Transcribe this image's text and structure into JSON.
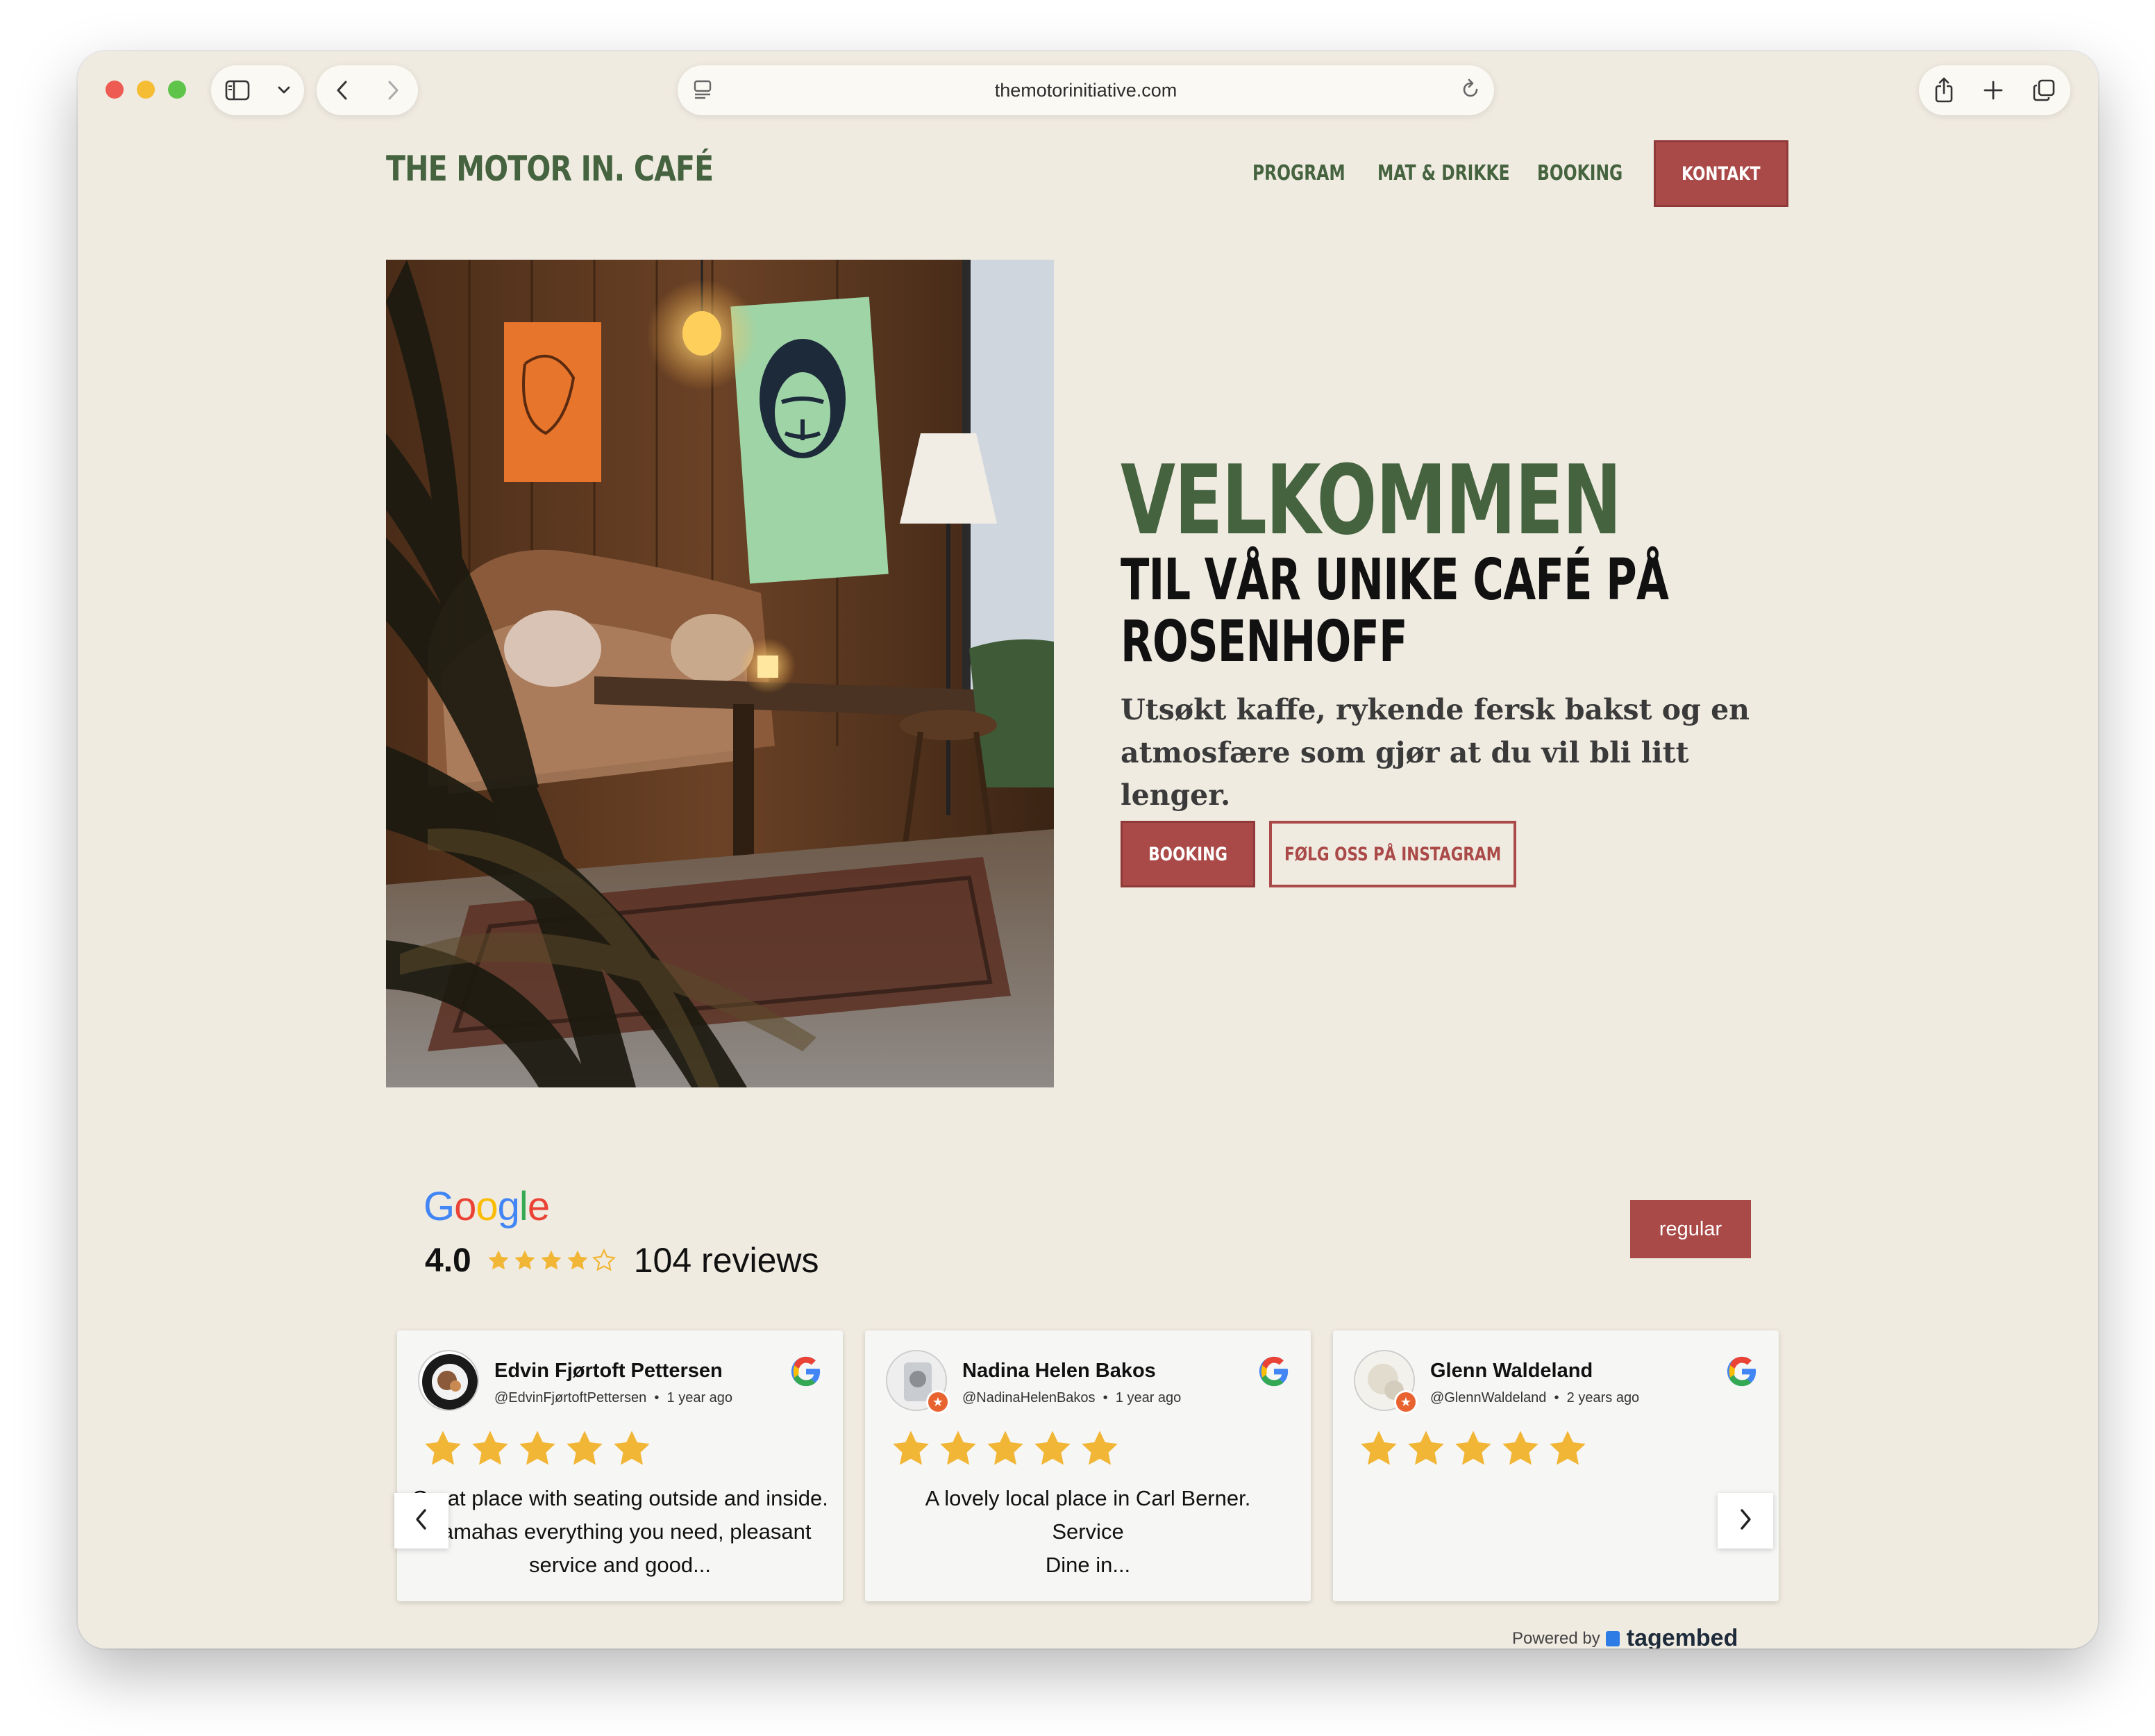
{
  "browser": {
    "url": "themotorinitiative.com"
  },
  "site": {
    "brand": "THE MOTOR IN. CAFÉ",
    "nav": {
      "program": "PROGRAM",
      "mat": "MAT & DRIKKE",
      "booking": "BOOKING",
      "kontakt": "KONTAKT"
    }
  },
  "hero": {
    "title": "VELKOMMEN",
    "subtitle_line1": "TIL VÅR UNIKE CAFÉ PÅ",
    "subtitle_line2": "ROSENHOFF",
    "lead": "Utsøkt kaffe, rykende fersk bakst og en atmosfære som gjør at du vil bli litt lenger.",
    "btn_booking": "BOOKING",
    "btn_instagram": "FØLG OSS PÅ INSTAGRAM"
  },
  "reviews": {
    "provider": "Google",
    "rating": "4.0",
    "stars": 4,
    "count_text": "104 reviews",
    "filter_button": "regular",
    "cards": [
      {
        "name": "Edvin Fjørtoft Pettersen",
        "handle": "@EdvinFjørtoftPettersen",
        "time": "1 year ago",
        "stars": 5,
        "text": "Great place with seating outside and inside. Yamahas everything you need, pleasant service and good..."
      },
      {
        "name": "Nadina Helen Bakos",
        "handle": "@NadinaHelenBakos",
        "time": "1 year ago",
        "stars": 5,
        "text_line1": "A lovely local place in Carl Berner.",
        "text_line2": "Service",
        "text_line3": "Dine in..."
      },
      {
        "name": "Glenn Waldeland",
        "handle": "@GlennWaldeland",
        "time": "2 years ago",
        "stars": 5,
        "text": ""
      }
    ],
    "powered_by": "Powered by",
    "powered_brand": "tagembed"
  },
  "colors": {
    "page_bg": "#f0ebe1",
    "brand_green": "#45633f",
    "accent_red": "#aa4a48",
    "star_gold": "#f2b636"
  }
}
